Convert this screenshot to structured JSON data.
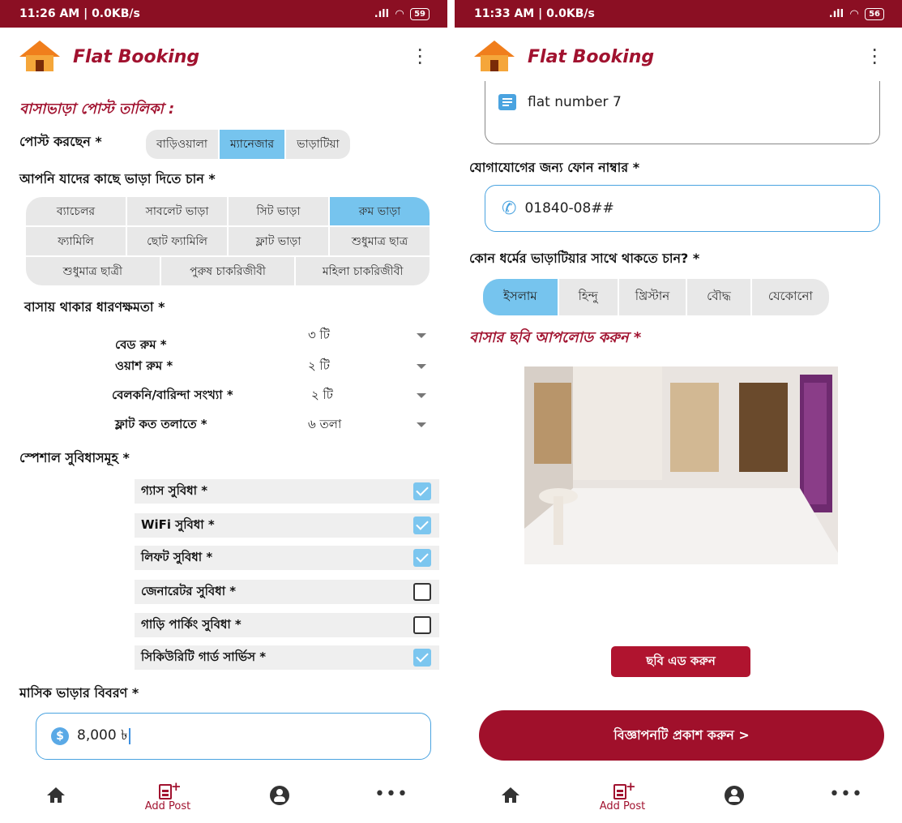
{
  "left": {
    "status": {
      "time": "11:26 AM | 0.0KB/s",
      "signal": ".ıll",
      "battery": "59"
    },
    "app_title": "Flat Booking",
    "section_title": "বাসাভাড়া পোস্ট তালিকা :",
    "poster": {
      "label": "পোস্ট করছেন *",
      "options": [
        "বাড়িওয়ালা",
        "ম্যানেজার",
        "ভাড়াটিয়া"
      ],
      "selected": "ম্যানেজার"
    },
    "tenant": {
      "label": "আপনি যাদের কাছে ভাড়া দিতে চান *",
      "rows": [
        [
          "ব্যাচেলর",
          "সাবলেট ভাড়া",
          "সিট ভাড়া",
          "রুম ভাড়া"
        ],
        [
          "ফ্যামিলি",
          "ছোট ফ্যামিলি",
          "ফ্লাট ভাড়া",
          "শুধুমাত্র ছাত্র"
        ],
        [
          "শুধুমাত্র ছাত্রী",
          "পুরুষ চাকরিজীবী",
          "মহিলা চাকরিজীবী"
        ]
      ],
      "selected": "রুম ভাড়া"
    },
    "capacity": {
      "label": "বাসায় থাকার ধারণক্ষমতা *",
      "items": [
        {
          "label": "বেড রুম *",
          "value": "৩ টি"
        },
        {
          "label": "ওয়াশ রুম *",
          "value": "২ টি"
        },
        {
          "label": "বেলকনি/বারিন্দা সংখ্যা *",
          "value": "২ টি"
        },
        {
          "label": "ফ্লাট কত তলাতে *",
          "value": "৬ তলা"
        }
      ]
    },
    "facilities": {
      "label": "স্পেশাল সুবিধাসমূহ *",
      "items": [
        {
          "label": "গ্যাস সুবিধা *",
          "checked": true
        },
        {
          "label": "WiFi সুবিধা *",
          "checked": true
        },
        {
          "label": "লিফট সুবিধা *",
          "checked": true
        },
        {
          "label": "জেনারেটর সুবিধা *",
          "checked": false
        },
        {
          "label": "গাড়ি পার্কিং সুবিধা *",
          "checked": false
        },
        {
          "label": "সিকিউরিটি গার্ড সার্ভিস *",
          "checked": true
        }
      ]
    },
    "rent": {
      "label": "মাসিক ভাড়ার বিবরণ *",
      "value": "8,000 ৳",
      "icon": "$"
    },
    "nav": {
      "add_post": "Add Post"
    }
  },
  "right": {
    "status": {
      "time": "11:33 AM | 0.0KB/s",
      "signal": ".ıll",
      "battery": "56"
    },
    "app_title": "Flat Booking",
    "address_value": "flat number 7",
    "phone": {
      "label": "যোগাযোগের জন্য ফোন নাম্বার *",
      "value": "01840-08##"
    },
    "religion": {
      "label": "কোন ধর্মের ভাড়াটিয়ার সাথে থাকতে চান? *",
      "options": [
        "ইসলাম",
        "হিন্দু",
        "খ্রিস্টান",
        "বৌদ্ধ",
        "যেকোনো"
      ],
      "selected": "ইসলাম"
    },
    "upload_title": "বাসার ছবি আপলোড করুন *",
    "add_photo_button": "ছবি এড করুন",
    "publish_button": "বিজ্ঞাপনটি প্রকাশ করুন >",
    "nav": {
      "add_post": "Add Post"
    }
  },
  "colors": {
    "brand": "#a1122f",
    "statusbar": "#8b0f23",
    "selected": "#76c4ee",
    "accent_blue": "#4aa3e0"
  }
}
